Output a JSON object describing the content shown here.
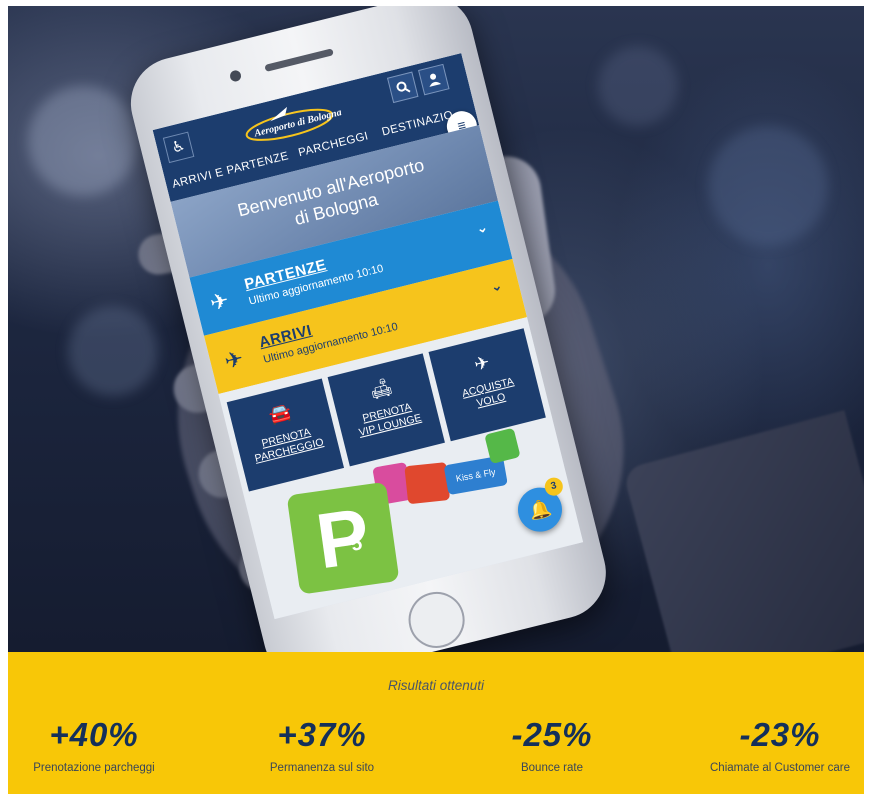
{
  "app": {
    "logo_text": "Aeroporto di Bologna",
    "accessibility_icon": "wheelchair-icon",
    "search_icon": "search-icon",
    "user_icon": "user-icon",
    "menu_icon": "hamburger-icon",
    "nav": [
      "ARRIVI E PARTENZE",
      "PARCHEGGI",
      "DESTINAZIO"
    ],
    "welcome_line1": "Benvenuto all'Aeroporto",
    "welcome_line2": "di Bologna",
    "departures": {
      "title": "PARTENZE",
      "subtitle": "Ultimo aggiornamento 10:10",
      "icon": "plane-takeoff-icon"
    },
    "arrivals": {
      "title": "ARRIVI",
      "subtitle": "Ultimo aggiornamento 10:10",
      "icon": "plane-landing-icon"
    },
    "tiles": [
      {
        "line1": "PRENOTA",
        "line2": "PARCHEGGIO",
        "icon": "car-icon"
      },
      {
        "line1": "PRENOTA",
        "line2": "VIP LOUNGE",
        "icon": "sofa-icon"
      },
      {
        "line1": "ACQUISTA",
        "line2": "VOLO",
        "icon": "plane-icon"
      }
    ],
    "parking_sign": "P",
    "parking_number": "5",
    "kiss_fly": "Kiss & Fly",
    "notification_count": "3",
    "bell_icon": "bell-icon"
  },
  "results": {
    "title": "Risultati ottenuti",
    "stats": [
      {
        "value": "+40%",
        "label": "Prenotazione parcheggi"
      },
      {
        "value": "+37%",
        "label": "Permanenza sul sito"
      },
      {
        "value": "-25%",
        "label": "Bounce rate"
      },
      {
        "value": "-23%",
        "label": "Chiamate al Customer care"
      }
    ]
  },
  "colors": {
    "navy": "#1c3d6e",
    "blue": "#1f8ad4",
    "yellow": "#f8c707",
    "green": "#7cc243"
  }
}
